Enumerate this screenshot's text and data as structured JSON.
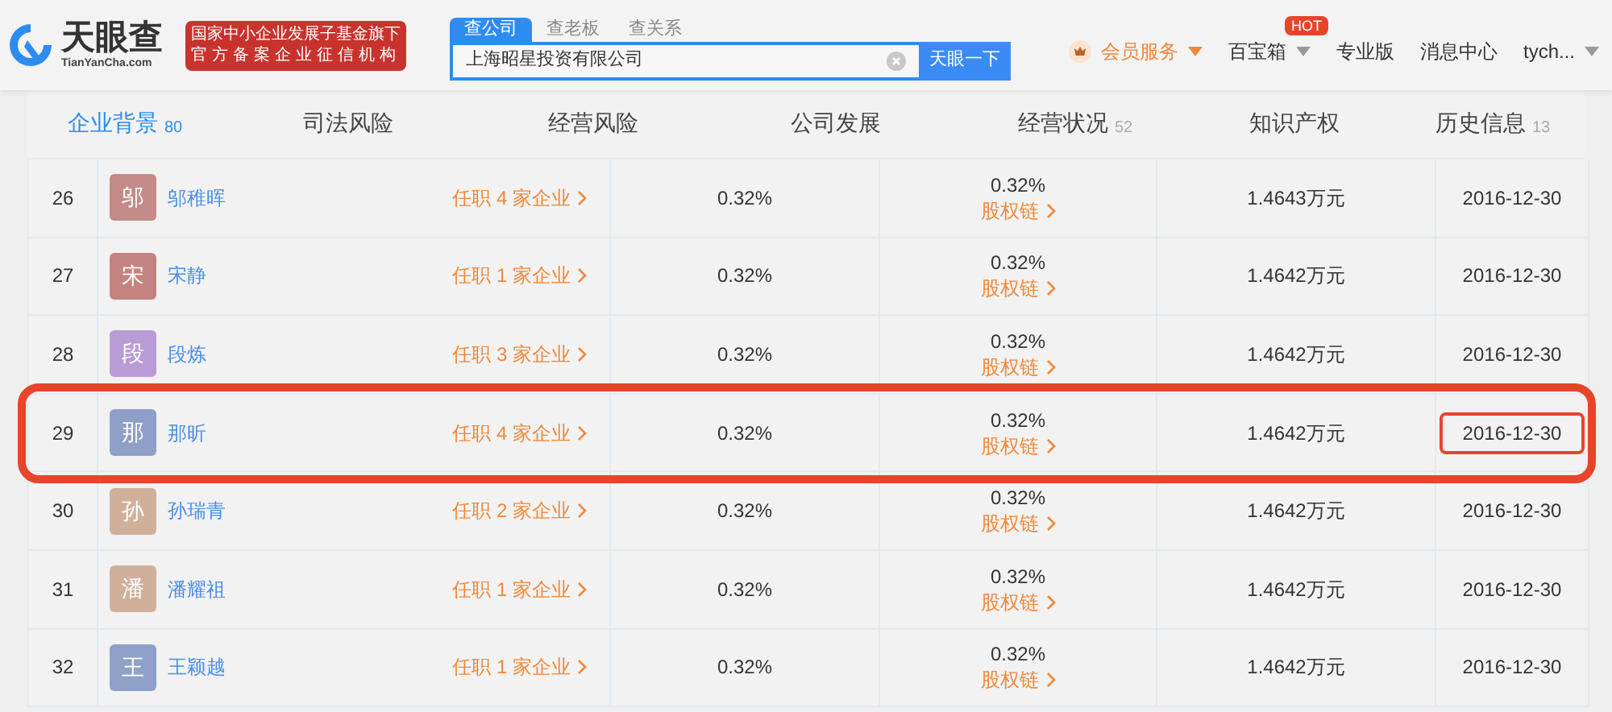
{
  "header": {
    "logo": {
      "name": "天眼查",
      "domain": "TianYanCha.com"
    },
    "badge": [
      "国家中小企业发展子基金旗下",
      "官方备案企业征信机构"
    ],
    "search_tabs": [
      {
        "label": "查公司",
        "selected": true
      },
      {
        "label": "查老板",
        "selected": false
      },
      {
        "label": "查关系",
        "selected": false
      }
    ],
    "search": {
      "value": "上海昭星投资有限公司",
      "button": "天眼一下"
    },
    "nav": [
      {
        "label": "会员服务",
        "kind": "vip"
      },
      {
        "label": "百宝箱",
        "kind": "hot",
        "badge": "HOT"
      },
      {
        "label": "专业版",
        "kind": "plain"
      },
      {
        "label": "消息中心",
        "kind": "plain"
      },
      {
        "label": "tych...",
        "kind": "menu"
      }
    ]
  },
  "section_tabs": [
    {
      "label": "企业背景",
      "count": "80",
      "selected": true
    },
    {
      "label": "司法风险",
      "selected": false
    },
    {
      "label": "经营风险",
      "selected": false
    },
    {
      "label": "公司发展",
      "selected": false
    },
    {
      "label": "经营状况",
      "count": "52",
      "selected": false
    },
    {
      "label": "知识产权",
      "selected": false
    },
    {
      "label": "历史信息",
      "count": "13",
      "selected": false
    }
  ],
  "rows": [
    {
      "index": "26",
      "initial": "邬",
      "color": "#c48a87",
      "name": "邬稚晖",
      "positions": "任职 4 家企业",
      "ratio": "0.32%",
      "chain_ratio": "0.32%",
      "chain": "股权链",
      "amount": "1.4643万元",
      "date": "2016-12-30",
      "highlighted": false
    },
    {
      "index": "27",
      "initial": "宋",
      "color": "#c4837f",
      "name": "宋静",
      "positions": "任职 1 家企业",
      "ratio": "0.32%",
      "chain_ratio": "0.32%",
      "chain": "股权链",
      "amount": "1.4642万元",
      "date": "2016-12-30",
      "highlighted": false
    },
    {
      "index": "28",
      "initial": "段",
      "color": "#b99cd6",
      "name": "段炼",
      "positions": "任职 3 家企业",
      "ratio": "0.32%",
      "chain_ratio": "0.32%",
      "chain": "股权链",
      "amount": "1.4642万元",
      "date": "2016-12-30",
      "highlighted": false
    },
    {
      "index": "29",
      "initial": "那",
      "color": "#8fa0c8",
      "name": "那昕",
      "positions": "任职 4 家企业",
      "ratio": "0.32%",
      "chain_ratio": "0.32%",
      "chain": "股权链",
      "amount": "1.4642万元",
      "date": "2016-12-30",
      "highlighted": true
    },
    {
      "index": "30",
      "initial": "孙",
      "color": "#d0b09a",
      "name": "孙瑞青",
      "positions": "任职 2 家企业",
      "ratio": "0.32%",
      "chain_ratio": "0.32%",
      "chain": "股权链",
      "amount": "1.4642万元",
      "date": "2016-12-30",
      "highlighted": false
    },
    {
      "index": "31",
      "initial": "潘",
      "color": "#d0b09b",
      "name": "潘耀祖",
      "positions": "任职 1 家企业",
      "ratio": "0.32%",
      "chain_ratio": "0.32%",
      "chain": "股权链",
      "amount": "1.4642万元",
      "date": "2016-12-30",
      "highlighted": false
    },
    {
      "index": "32",
      "initial": "王",
      "color": "#8fa0c9",
      "name": "王颖越",
      "positions": "任职 1 家企业",
      "ratio": "0.32%",
      "chain_ratio": "0.32%",
      "chain": "股权链",
      "amount": "1.4642万元",
      "date": "2016-12-30",
      "highlighted": false
    }
  ]
}
